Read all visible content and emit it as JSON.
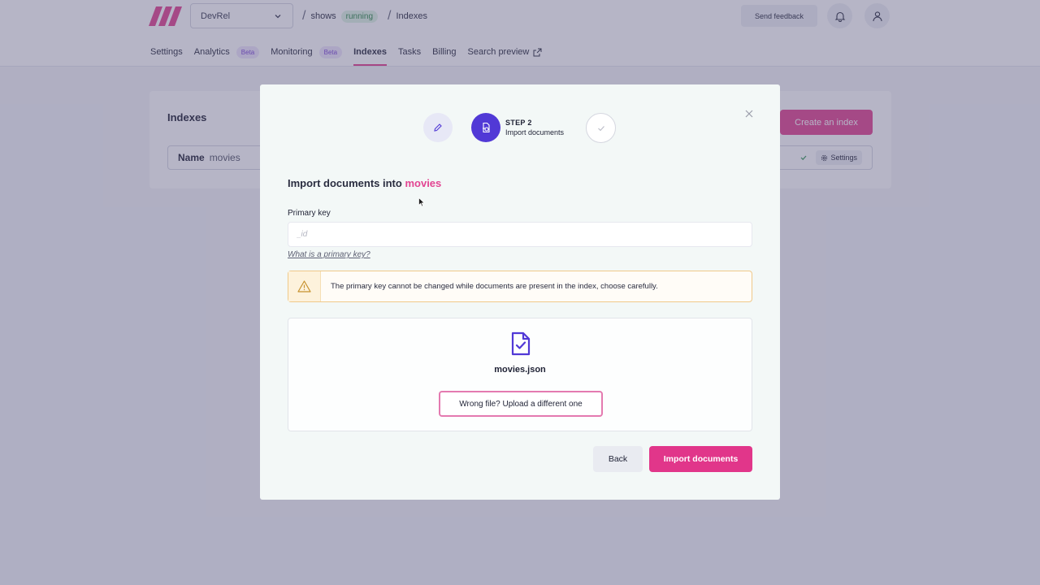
{
  "topbar": {
    "org": "DevRel",
    "breadcrumb": {
      "project": "shows",
      "status": "running",
      "page": "Indexes"
    },
    "send_feedback": "Send feedback"
  },
  "nav": {
    "settings": "Settings",
    "analytics": "Analytics",
    "analytics_badge": "Beta",
    "monitoring": "Monitoring",
    "monitoring_badge": "Beta",
    "indexes": "Indexes",
    "tasks": "Tasks",
    "billing": "Billing",
    "search_preview": "Search preview"
  },
  "indexes_card": {
    "title": "Indexes",
    "create_button": "Create an index",
    "name_label": "Name",
    "name_value": "movies",
    "settings_button": "Settings"
  },
  "modal": {
    "step_number": "STEP 2",
    "step_label": "Import documents",
    "title_prefix": "Import documents into",
    "title_index": "movies",
    "primary_key_label": "Primary key",
    "primary_key_placeholder": "_id",
    "primary_key_help": "What is a primary key?",
    "warning": "The primary key cannot be changed while documents are present in the index, choose carefully.",
    "file_name": "movies.json",
    "wrong_file_button": "Wrong file? Upload a different one",
    "back_button": "Back",
    "import_button": "Import documents"
  },
  "colors": {
    "accent": "#e24592",
    "step_active": "#5139d6",
    "warning_border": "#f0c98a"
  }
}
